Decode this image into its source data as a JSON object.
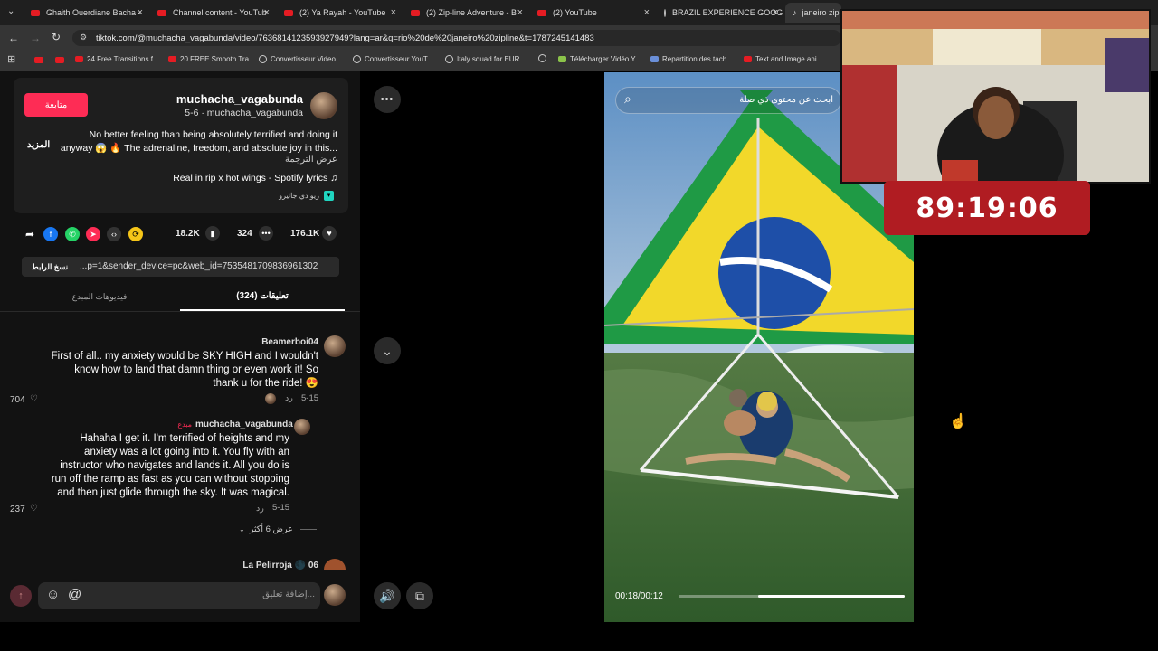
{
  "browser": {
    "tabs": [
      {
        "label": "Ghaith Ouerdiane Bacha -",
        "icon": "youtube-icon"
      },
      {
        "label": "Channel content - YouTub",
        "icon": "youtube-icon"
      },
      {
        "label": "(2) Ya Rayah - YouTube",
        "icon": "youtube-icon"
      },
      {
        "label": "(2) Zip-line Adventure - B",
        "icon": "youtube-icon"
      },
      {
        "label": "(2) YouTube",
        "icon": "youtube-icon"
      },
      {
        "label": "BRAZIL EXPERIENCE GOOG",
        "icon": "globe-icon"
      },
      {
        "label": "janeiro zip",
        "icon": "tiktok-icon"
      }
    ],
    "url": "tiktok.com/@muchacha_vagabunda/video/7636814123593927949?lang=ar&q=rio%20de%20janeiro%20zipline&t=1787245141483",
    "bookmarks": [
      "24 Free Transitions f...",
      "20 FREE Smooth Tra...",
      "Convertisseur Video...",
      "Convertisseur YouT...",
      "Italy squad for EUR...",
      "Télécharger Vidéo Y...",
      "Repartition des tach...",
      "Text and Image ani..."
    ]
  },
  "post": {
    "follow_label": "متابعة",
    "username": "muchacha_vagabunda",
    "subline": "5-6 · muchacha_vagabunda",
    "more_label": "المزيد",
    "caption_line1": "No better feeling than being absolutely terrified and doing it",
    "caption_line2": "anyway 😱 🔥 The adrenaline, freedom, and absolute joy in this...",
    "translate_label": "عرض الترجمة",
    "music": "Real in rip x hot wings - Spotify lyrics ♫",
    "location": "ريو دي جانيرو",
    "shares": "18.2K",
    "comments_count": "324",
    "likes": "176.1K",
    "copy_link_label": "نسخ الرابط",
    "link_text": "...p=1&sender_device=pc&web_id=7535481709836961302",
    "tab_comments": "(324) تعليقات",
    "tab_creator_videos": "فيديوهات المبدع"
  },
  "comments": [
    {
      "user": "Beamerboi04",
      "lines": [
        "First of all.. my anxiety would be SKY HIGH and I wouldn't",
        "know how to land that damn thing or even work it! So",
        "thank u for the ride! 😍"
      ],
      "date": "5-15",
      "reply_label": "رد",
      "likes": "704"
    },
    {
      "user": "muchacha_vagabunda",
      "creator_badge": "مبدع",
      "lines": [
        "Hahaha I get it. I'm terrified of heights and my",
        "anxiety was a lot going into it. You fly with an",
        "instructor who navigates and lands it. All you do is",
        "run off the ramp as fast as you can without stopping",
        "and then just glide through the sky. It was magical."
      ],
      "date": "5-15",
      "reply_label": "رد",
      "likes": "237"
    },
    {
      "user": "La Pelirroja 🌑 06",
      "lines": []
    }
  ],
  "view_more_label": "عرض 6 أكثر",
  "comment_input_placeholder": "إضافة تعليق...",
  "video": {
    "search_placeholder": "ابحث عن محتوى ذي صلة",
    "time": "00:18/00:12",
    "progress": 0.65
  },
  "overlay": {
    "timer": "89:19:06"
  }
}
